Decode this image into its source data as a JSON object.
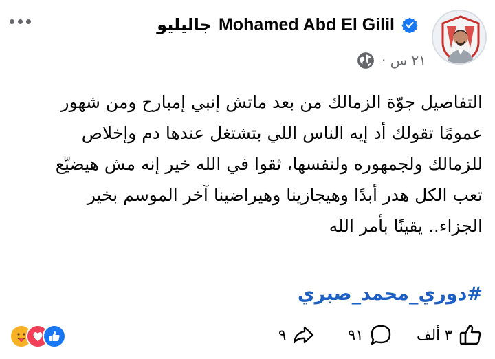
{
  "post": {
    "author_name": "Mohamed Abd El Gilil",
    "group_name": "جاليليو",
    "timestamp": "٢١ س ·",
    "privacy_icon": "globe-icon",
    "more_icon": "more-options-icon",
    "body_lines": [
      "التفاصيل جوّة الزمالك من بعد ماتش إنبي إمبارح ومن شهور",
      "عمومًا تقولك أد إيه الناس اللي بتشتغل عندها دم وإخلاص",
      "للزمالك ولجمهوره ولنفسها، ثقوا في الله خير إنه مش هيضيّع",
      "تعب الكل هدر أبدًا وهيجازينا وهيراضينا آخر الموسم بخير",
      "الجزاء.. يقينًا بأمر الله"
    ],
    "hashtag": "#دوري_محمد_صبري"
  },
  "footer": {
    "like_count": "٣ ألف",
    "comment_count": "٩١",
    "share_count": "٩",
    "reactions": [
      "like",
      "love",
      "care"
    ]
  },
  "colors": {
    "hashtag": "#1b5fc4",
    "verified": "#1877f2",
    "like": "#1877f2",
    "love": "#f33e58",
    "care": "#f7b125",
    "secondary_text": "#65676b"
  }
}
